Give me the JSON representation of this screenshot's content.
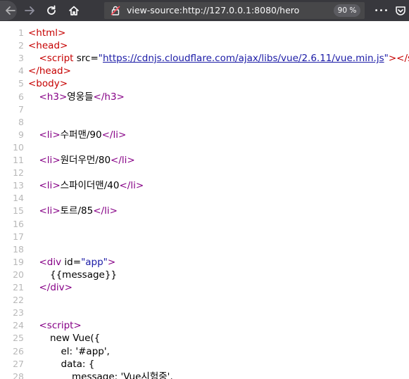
{
  "toolbar": {
    "url": "view-source:http://127.0.0.1:8080/hero",
    "zoom": "90 %",
    "more_label": "•••"
  },
  "icons": {
    "back": "back-arrow-icon",
    "forward": "forward-arrow-icon",
    "reload": "reload-icon",
    "home": "home-icon",
    "insecure": "insecure-lock-icon",
    "more": "more-actions-icon",
    "pocket": "pocket-icon"
  },
  "source_lines": [
    {
      "n": "1",
      "parts": [
        {
          "t": "tag root",
          "s": "<html>"
        }
      ],
      "indent": 0
    },
    {
      "n": "2",
      "parts": [
        {
          "t": "tag root",
          "s": "<head>"
        }
      ],
      "indent": 0
    },
    {
      "n": "3",
      "parts": [
        {
          "t": "tag root",
          "s": "<script "
        },
        {
          "t": "attr",
          "s": "src="
        },
        {
          "t": "val",
          "s": "\""
        },
        {
          "t": "link",
          "s": "https://cdnjs.cloudflare.com/ajax/libs/vue/2.6.11/vue.min.js"
        },
        {
          "t": "val",
          "s": "\""
        },
        {
          "t": "tag root",
          "s": "></scri"
        }
      ],
      "indent": 1
    },
    {
      "n": "4",
      "parts": [
        {
          "t": "tag root",
          "s": "</head>"
        }
      ],
      "indent": 0
    },
    {
      "n": "5",
      "parts": [
        {
          "t": "tag root",
          "s": "<body>"
        }
      ],
      "indent": 0
    },
    {
      "n": "6",
      "parts": [
        {
          "t": "tag",
          "s": "<h3>"
        },
        {
          "t": "plain",
          "s": "영웅들"
        },
        {
          "t": "tag",
          "s": "</h3>"
        }
      ],
      "indent": 1
    },
    {
      "n": "7",
      "parts": [],
      "indent": 0
    },
    {
      "n": "8",
      "parts": [],
      "indent": 0
    },
    {
      "n": "9",
      "parts": [
        {
          "t": "tag",
          "s": "<li>"
        },
        {
          "t": "plain",
          "s": "수퍼맨/90"
        },
        {
          "t": "tag",
          "s": "</li>"
        }
      ],
      "indent": 1
    },
    {
      "n": "10",
      "parts": [],
      "indent": 0
    },
    {
      "n": "11",
      "parts": [
        {
          "t": "tag",
          "s": "<li>"
        },
        {
          "t": "plain",
          "s": "원더우먼/80"
        },
        {
          "t": "tag",
          "s": "</li>"
        }
      ],
      "indent": 1
    },
    {
      "n": "12",
      "parts": [],
      "indent": 0
    },
    {
      "n": "13",
      "parts": [
        {
          "t": "tag",
          "s": "<li>"
        },
        {
          "t": "plain",
          "s": "스파이더맨/40"
        },
        {
          "t": "tag",
          "s": "</li>"
        }
      ],
      "indent": 1
    },
    {
      "n": "14",
      "parts": [],
      "indent": 0
    },
    {
      "n": "15",
      "parts": [
        {
          "t": "tag",
          "s": "<li>"
        },
        {
          "t": "plain",
          "s": "토르/85"
        },
        {
          "t": "tag",
          "s": "</li>"
        }
      ],
      "indent": 1
    },
    {
      "n": "16",
      "parts": [],
      "indent": 0
    },
    {
      "n": "17",
      "parts": [],
      "indent": 0
    },
    {
      "n": "18",
      "parts": [],
      "indent": 0
    },
    {
      "n": "19",
      "parts": [
        {
          "t": "tag",
          "s": "<div "
        },
        {
          "t": "attr",
          "s": "id="
        },
        {
          "t": "val",
          "s": "\"app\""
        },
        {
          "t": "tag",
          "s": ">"
        }
      ],
      "indent": 1
    },
    {
      "n": "20",
      "parts": [
        {
          "t": "plain",
          "s": "{{message}}"
        }
      ],
      "indent": 2
    },
    {
      "n": "21",
      "parts": [
        {
          "t": "tag",
          "s": "</div>"
        }
      ],
      "indent": 1
    },
    {
      "n": "22",
      "parts": [],
      "indent": 0
    },
    {
      "n": "23",
      "parts": [],
      "indent": 0
    },
    {
      "n": "24",
      "parts": [
        {
          "t": "tag",
          "s": "<script>"
        }
      ],
      "indent": 1
    },
    {
      "n": "25",
      "parts": [
        {
          "t": "plain",
          "s": "new Vue({"
        }
      ],
      "indent": 2
    },
    {
      "n": "26",
      "parts": [
        {
          "t": "plain",
          "s": "el: '#app',"
        }
      ],
      "indent": 3
    },
    {
      "n": "27",
      "parts": [
        {
          "t": "plain",
          "s": "data: {"
        }
      ],
      "indent": 3
    },
    {
      "n": "28",
      "parts": [
        {
          "t": "plain",
          "s": "message: 'Vue시험중',"
        }
      ],
      "indent": 4
    }
  ]
}
